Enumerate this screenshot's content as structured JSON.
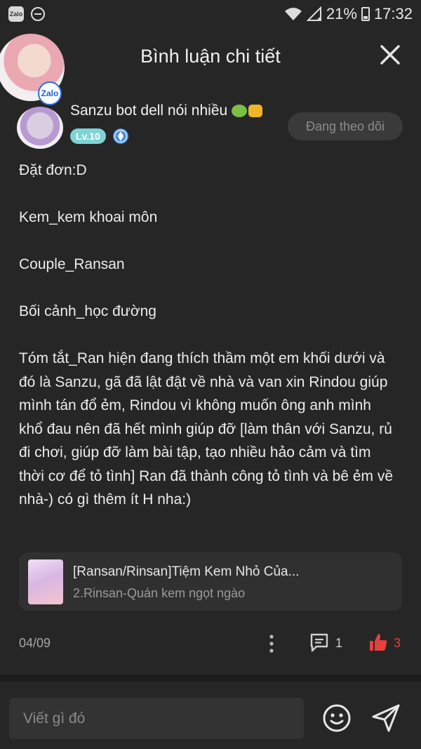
{
  "status_bar": {
    "app_badge": "Zalo",
    "battery": "21%",
    "time": "17:32"
  },
  "header": {
    "title": "Bình luận chi tiết"
  },
  "floating_avatar": {
    "badge": "Zalo"
  },
  "comment": {
    "username": "Sanzu bot dell nói nhiều",
    "level": "Lv.10",
    "follow_label": "Đang theo dõi",
    "lines": [
      "Đặt đơn:D",
      "Kem_kem khoai môn",
      "Couple_Ransan",
      "Bối cảnh_học đường",
      "Tóm tắt_Ran hiện đang thích thầm một em khối dưới và đó là Sanzu, gã đã lật đật về nhà và van xin Rindou giúp mình tán đổ ẻm, Rindou vì không muốn ông anh mình khổ đau nên đã hết mình giúp đỡ [làm thân với Sanzu, rủ đi chơi, giúp đỡ làm bài tập, tạo nhiều hảo cảm và tìm thời cơ để tỏ tình] Ran đã thành công tỏ tình và bê ẻm về nhà-) có gì thêm ít H nha:)"
    ],
    "date": "04/09",
    "reply_count": "1",
    "like_count": "3"
  },
  "story_card": {
    "title": "[Ransan/Rinsan]Tiệm Kem Nhỏ Của...",
    "subtitle": "2.Rinsan-Quán kem ngọt ngào"
  },
  "compose": {
    "placeholder": "Viết gì đó"
  },
  "colors": {
    "background": "#262626",
    "level_badge": "#7ed4d4",
    "like_red": "#e5403c",
    "verify_blue": "#4a8fe8"
  }
}
